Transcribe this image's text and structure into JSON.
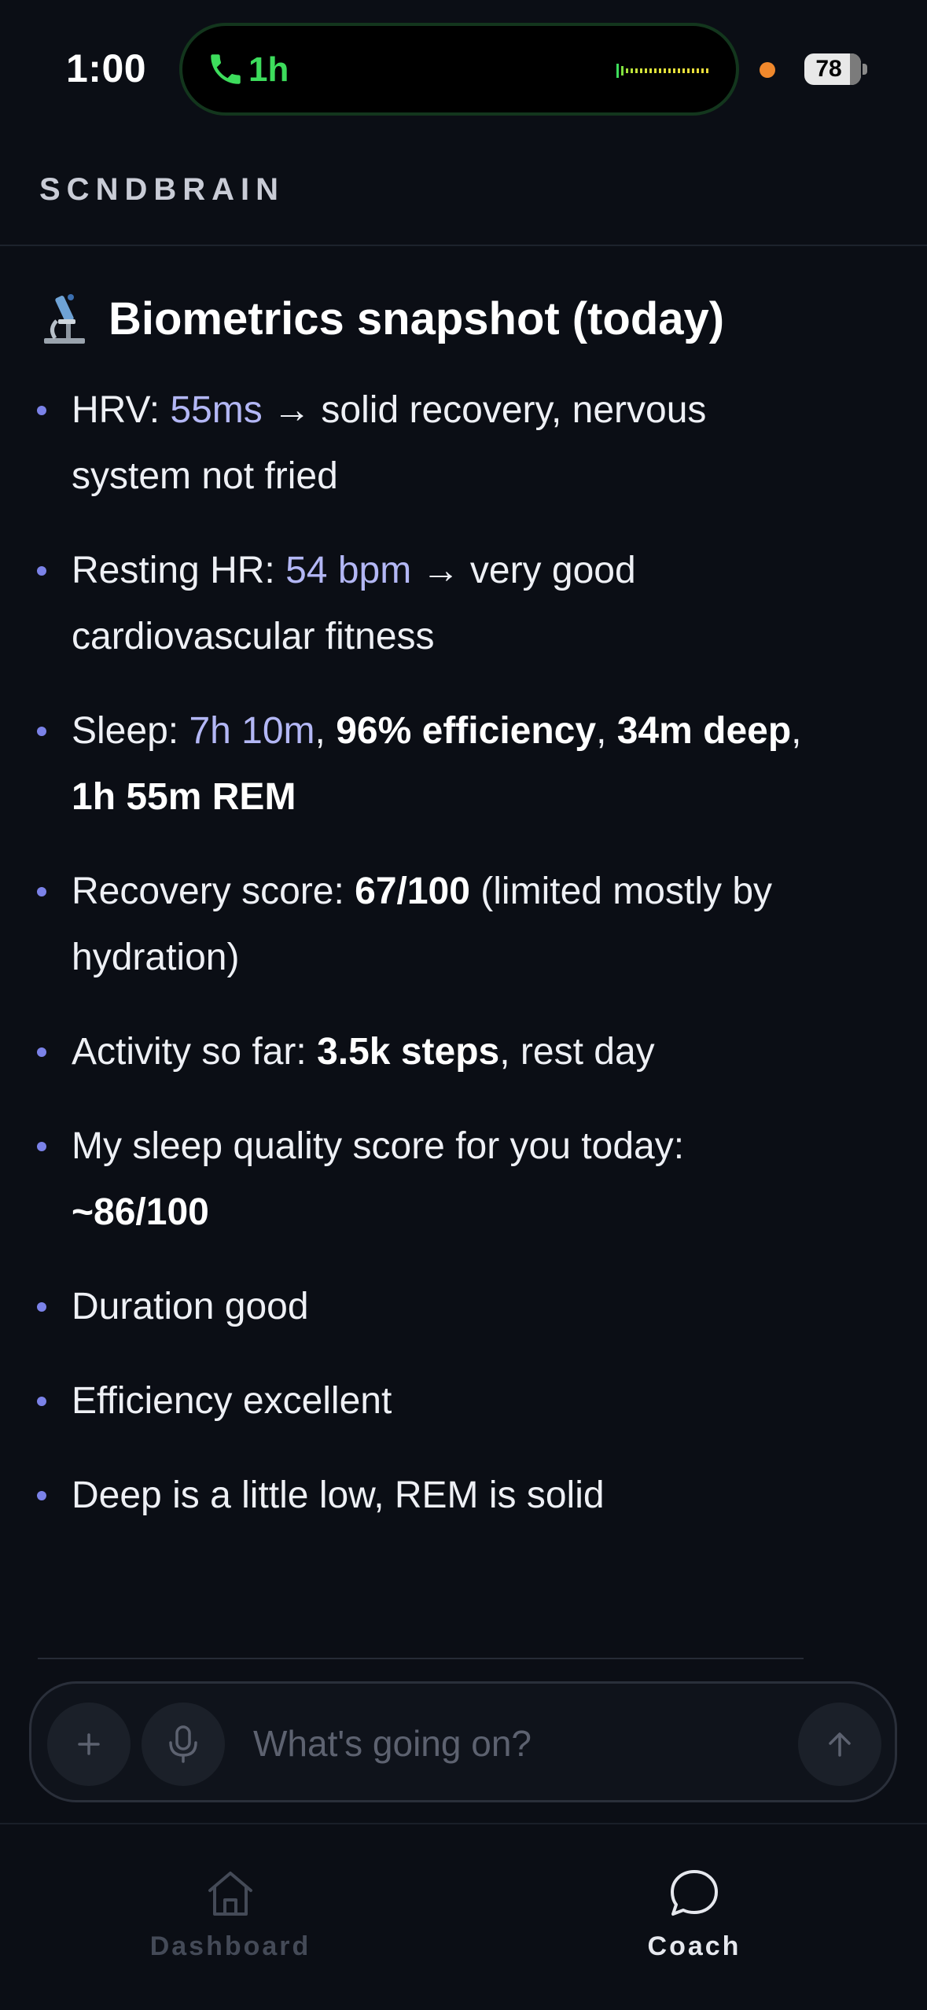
{
  "status_bar": {
    "time": "1:00",
    "call_duration": "1h",
    "battery_level": "78",
    "battery_fraction": 0.78
  },
  "app": {
    "name": "SCNDBRAIN"
  },
  "message": {
    "heading": "Biometrics snapshot (today)",
    "heading_icon": "microscope-icon",
    "bullets": [
      {
        "parts": [
          {
            "t": "HRV: ",
            "s": "plain"
          },
          {
            "t": "55ms",
            "s": "hl"
          },
          {
            "t": " → solid recovery, nervous system not fried",
            "s": "plain"
          }
        ]
      },
      {
        "parts": [
          {
            "t": "Resting HR: ",
            "s": "plain"
          },
          {
            "t": "54 bpm",
            "s": "hl"
          },
          {
            "t": " → very good cardiovascular fitness",
            "s": "plain"
          }
        ]
      },
      {
        "parts": [
          {
            "t": "Sleep: ",
            "s": "plain"
          },
          {
            "t": "7h 10m",
            "s": "hl"
          },
          {
            "t": ", ",
            "s": "plain"
          },
          {
            "t": "96% efficiency",
            "s": "b"
          },
          {
            "t": ", ",
            "s": "plain"
          },
          {
            "t": "34m deep",
            "s": "b"
          },
          {
            "t": ", ",
            "s": "plain"
          },
          {
            "t": "1h 55m REM",
            "s": "b"
          }
        ]
      },
      {
        "parts": [
          {
            "t": "Recovery score: ",
            "s": "plain"
          },
          {
            "t": "67/100",
            "s": "b"
          },
          {
            "t": " (limited mostly by hydration)",
            "s": "plain"
          }
        ]
      },
      {
        "parts": [
          {
            "t": "Activity so far: ",
            "s": "plain"
          },
          {
            "t": "3.5k steps",
            "s": "b"
          },
          {
            "t": ", rest day",
            "s": "plain"
          }
        ]
      },
      {
        "parts": [
          {
            "t": "My sleep quality score for you today: ",
            "s": "plain"
          },
          {
            "t": "~86/100",
            "s": "b"
          }
        ]
      },
      {
        "parts": [
          {
            "t": "Duration good",
            "s": "plain"
          }
        ]
      },
      {
        "parts": [
          {
            "t": "Efficiency excellent",
            "s": "plain"
          }
        ]
      },
      {
        "parts": [
          {
            "t": "Deep is a little low, REM is solid",
            "s": "plain"
          }
        ]
      }
    ]
  },
  "composer": {
    "placeholder": "What's going on?",
    "attach_icon": "plus-icon",
    "mic_icon": "microphone-icon",
    "send_icon": "arrow-up-icon"
  },
  "nav": {
    "items": [
      {
        "label": "Dashboard",
        "icon": "home-icon",
        "active": false
      },
      {
        "label": "Coach",
        "icon": "chat-bubble-icon",
        "active": true
      }
    ]
  },
  "colors": {
    "background": "#0b0e15",
    "highlight": "#b3b7f5",
    "bullet": "#7b82e8",
    "call_green": "#3ddc5c",
    "privacy_dot": "#f0882c"
  }
}
